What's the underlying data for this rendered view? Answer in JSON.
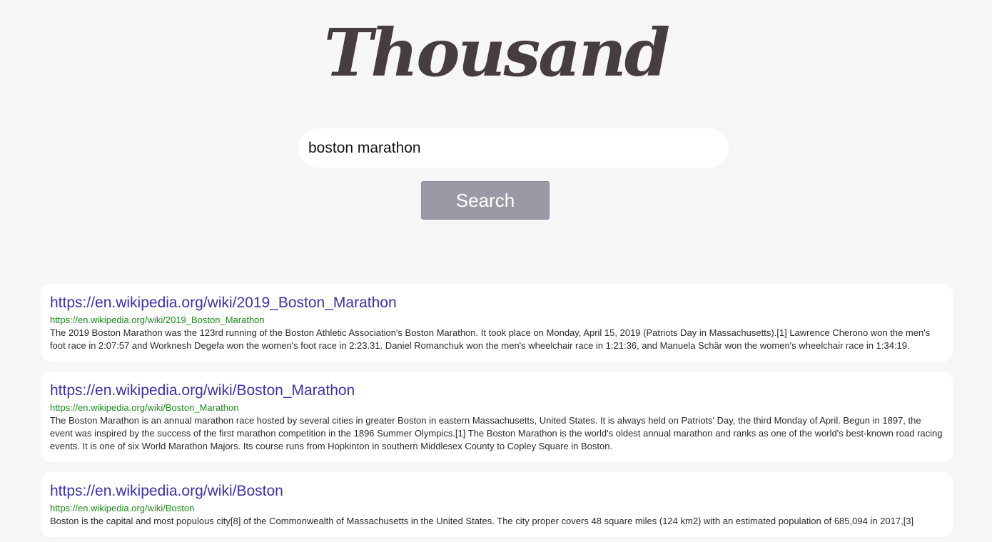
{
  "logo": {
    "text": "Thousand"
  },
  "search": {
    "value": "boston marathon",
    "button_label": "Search"
  },
  "results": [
    {
      "title": "https://en.wikipedia.org/wiki/2019_Boston_Marathon",
      "url": "https://en.wikipedia.org/wiki/2019_Boston_Marathon",
      "snippet": "The 2019 Boston Marathon was the 123rd running of the Boston Athletic Association's Boston Marathon. It took place on Monday, April 15, 2019 (Patriots Day in Massachusetts).[1] Lawrence Cherono won the men's foot race in 2:07:57 and Worknesh Degefa won the women's foot race in 2:23.31. Daniel Romanchuk won the men's wheelchair race in 1:21:36, and Manuela Schär won the women's wheelchair race in 1:34:19."
    },
    {
      "title": "https://en.wikipedia.org/wiki/Boston_Marathon",
      "url": "https://en.wikipedia.org/wiki/Boston_Marathon",
      "snippet": "The Boston Marathon is an annual marathon race hosted by several cities in greater Boston in eastern Massachusetts, United States. It is always held on Patriots' Day, the third Monday of April. Begun in 1897, the event was inspired by the success of the first marathon competition in the 1896 Summer Olympics.[1] The Boston Marathon is the world's oldest annual marathon and ranks as one of the world's best-known road racing events. It is one of six World Marathon Majors. Its course runs from Hopkinton in southern Middlesex County to Copley Square in Boston."
    },
    {
      "title": "https://en.wikipedia.org/wiki/Boston",
      "url": "https://en.wikipedia.org/wiki/Boston",
      "snippet": "Boston is the capital and most populous city[8] of the Commonwealth of Massachusetts in the United States. The city proper covers 48 square miles (124 km2) with an estimated population of 685,094 in 2017,[3]"
    }
  ],
  "colors": {
    "background": "#f6f6f6",
    "logo": "#463d3e",
    "link": "#3b32a8",
    "url": "#1c8a1c",
    "button": "#9c98a5"
  }
}
